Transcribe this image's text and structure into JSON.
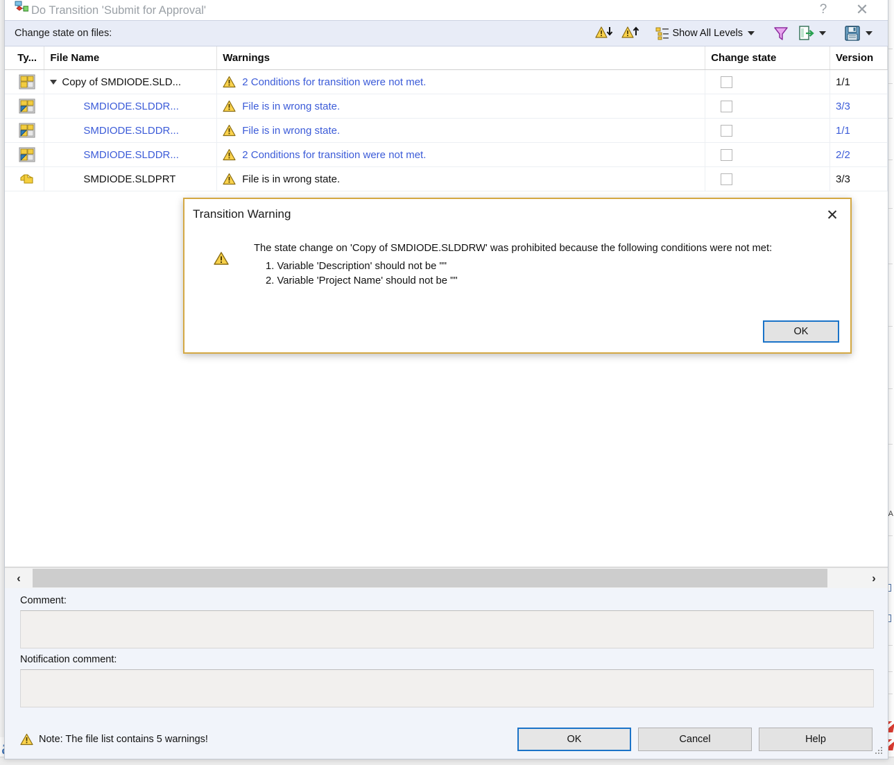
{
  "window": {
    "title": "Do Transition 'Submit for Approval'",
    "icon": "workflow-transition-icon",
    "help_label": "?",
    "close_label": "✕"
  },
  "subheader": {
    "label": "Change state on files:",
    "toolbar": {
      "prev_warning": "warning-down-icon",
      "next_warning": "warning-up-icon",
      "levels_icon": "tree-levels-icon",
      "levels_label": "Show All Levels",
      "filter_icon": "filter-funnel-icon",
      "export_icon": "export-file-icon",
      "save_icon": "save-disk-icon"
    }
  },
  "grid": {
    "columns": [
      "Ty...",
      "File Name",
      "Warnings",
      "Change state",
      "Version"
    ],
    "rows": [
      {
        "type_icon": "drawing-file-icon",
        "expander": true,
        "indent": 0,
        "name": "Copy of SMDIODE.SLD...",
        "name_link": false,
        "warning": "2 Conditions for transition were not met.",
        "change_state_checked": false,
        "version": "1/1",
        "version_link": false
      },
      {
        "type_icon": "drawing-file-icon",
        "expander": false,
        "indent": 1,
        "name": "SMDIODE.SLDDR...",
        "name_link": true,
        "warning": "File is in wrong state.",
        "change_state_checked": false,
        "version": "3/3",
        "version_link": true
      },
      {
        "type_icon": "drawing-file-icon",
        "expander": false,
        "indent": 1,
        "name": "SMDIODE.SLDDR...",
        "name_link": true,
        "warning": "File is in wrong state.",
        "change_state_checked": false,
        "version": "1/1",
        "version_link": true
      },
      {
        "type_icon": "drawing-file-icon",
        "expander": false,
        "indent": 1,
        "name": "SMDIODE.SLDDR...",
        "name_link": true,
        "warning": "2 Conditions for transition were not met.",
        "change_state_checked": false,
        "version": "2/2",
        "version_link": true
      },
      {
        "type_icon": "part-file-icon",
        "expander": false,
        "indent": 1,
        "name": "SMDIODE.SLDPRT",
        "name_link": false,
        "warning": "File is in wrong state.",
        "change_state_checked": false,
        "version": "3/3",
        "version_link": false
      }
    ]
  },
  "scrollbar": {
    "left_arrow": "‹",
    "right_arrow": "›"
  },
  "comments": {
    "comment_label": "Comment:",
    "comment_value": "",
    "notification_label": "Notification comment:",
    "notification_value": ""
  },
  "footer": {
    "note": "Note: The file list contains 5 warnings!",
    "note_icon": "warning-triangle-icon",
    "ok": "OK",
    "cancel": "Cancel",
    "help": "Help"
  },
  "modal": {
    "title": "Transition Warning",
    "close_label": "✕",
    "icon": "warning-triangle-icon",
    "lead": "The state change on 'Copy of SMDIODE.SLDDRW' was prohibited because the following conditions were not met:",
    "conditions": [
      "1. Variable 'Description' should not be \"\"",
      "2. Variable 'Project Name' should not be \"\""
    ],
    "ok": "OK"
  },
  "colors": {
    "link": "#3b5bd8",
    "warning_yellow": "#f2c037",
    "modal_border": "#d4a843",
    "accent_blue": "#1a73c8",
    "subheader_bg": "#e8ecf7"
  }
}
